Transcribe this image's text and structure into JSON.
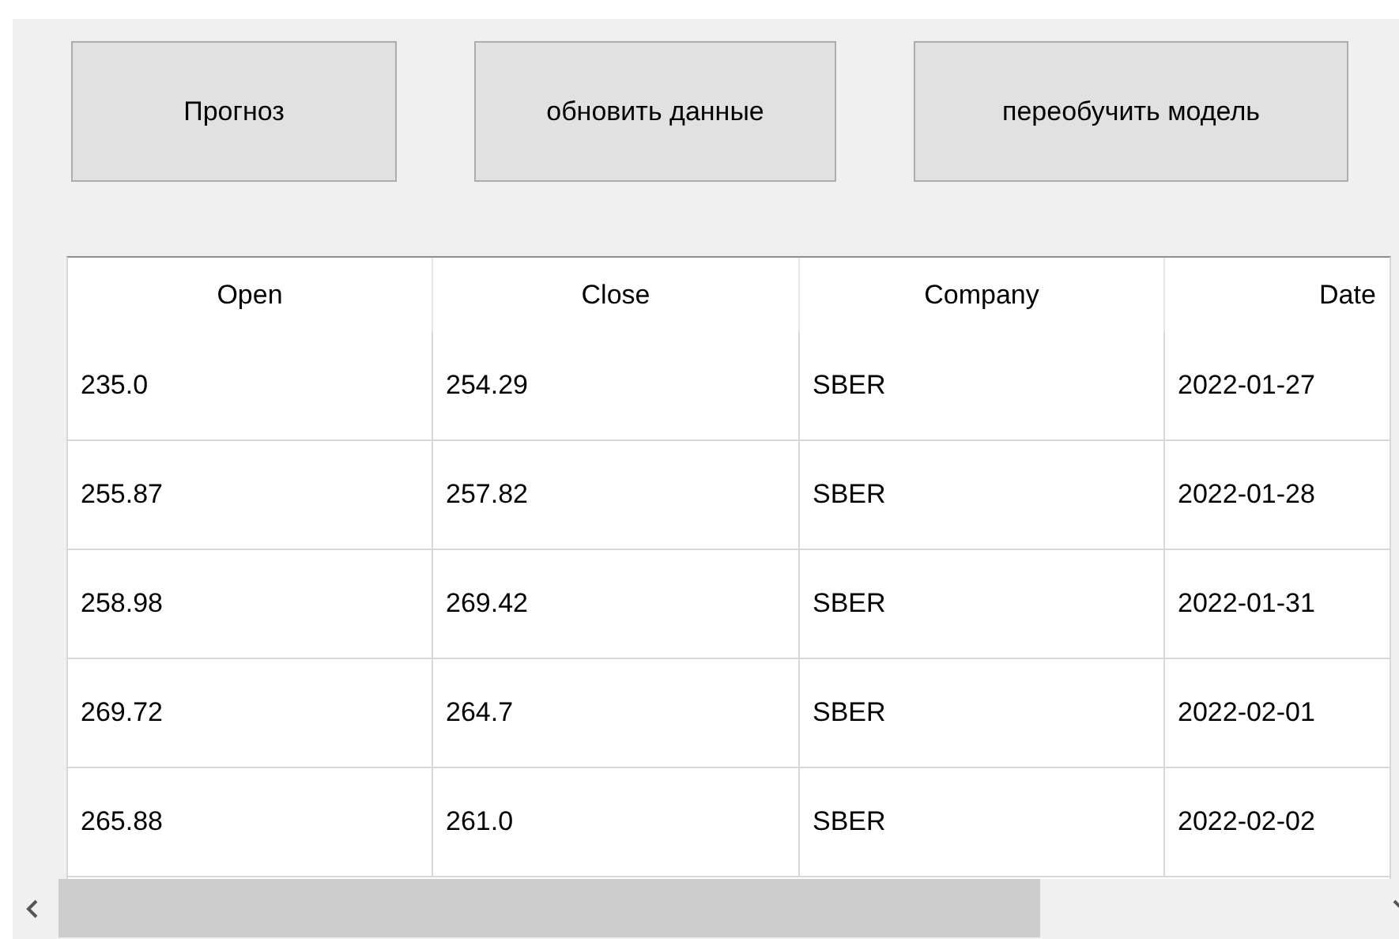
{
  "buttons": [
    "Прогноз",
    "обновить данные",
    "переобучить модель"
  ],
  "table": {
    "columns": [
      "Open",
      "Close",
      "Company",
      "Date"
    ],
    "rows": [
      [
        "235.0",
        "254.29",
        "SBER",
        "2022-01-27"
      ],
      [
        "255.87",
        "257.82",
        "SBER",
        "2022-01-28"
      ],
      [
        "258.98",
        "269.42",
        "SBER",
        "2022-01-31"
      ],
      [
        "269.72",
        "264.7",
        "SBER",
        "2022-02-01"
      ],
      [
        "265.88",
        "261.0",
        "SBER",
        "2022-02-02"
      ]
    ]
  },
  "scrollbar": {
    "kind": "horizontal"
  }
}
